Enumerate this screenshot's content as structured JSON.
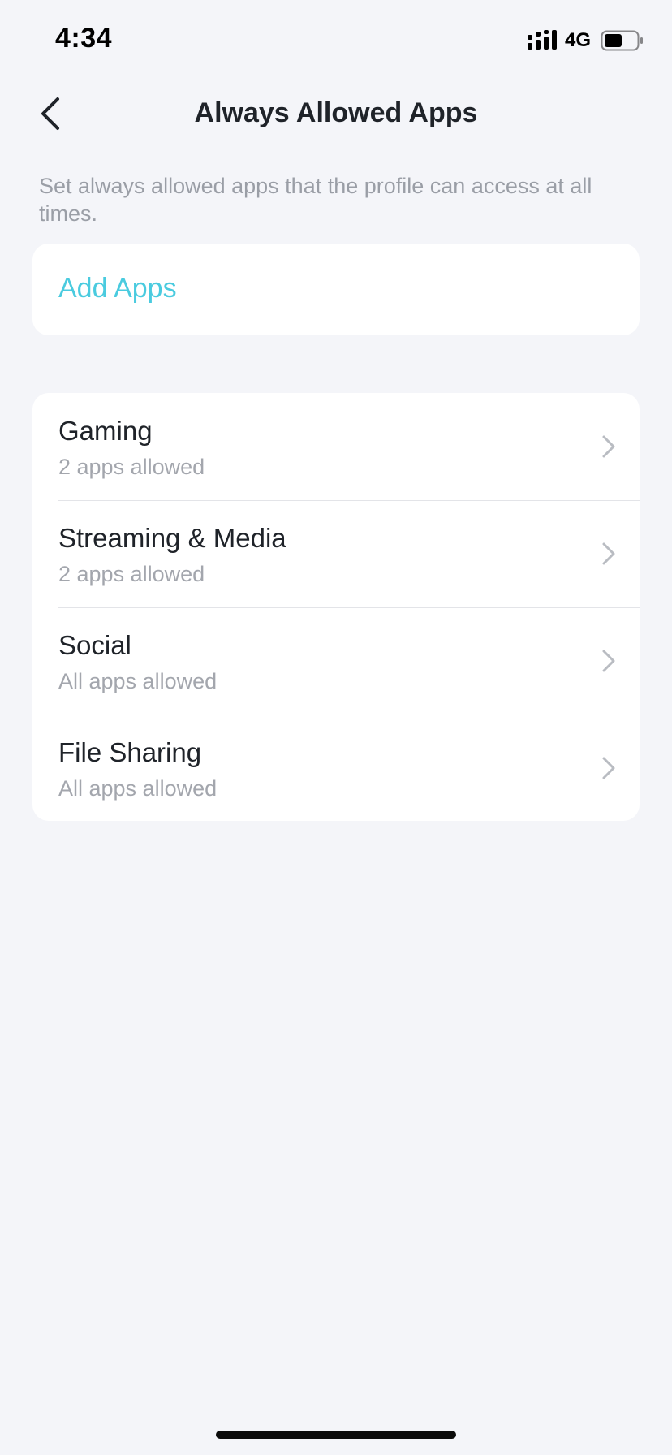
{
  "status_bar": {
    "time": "4:34",
    "network": "4G",
    "icons": [
      "signal-icon",
      "battery-icon"
    ]
  },
  "nav": {
    "title": "Always Allowed Apps",
    "back_icon": "chevron-left-icon"
  },
  "description": "Set always allowed apps that the profile can access at all times.",
  "add_apps": {
    "label": "Add Apps"
  },
  "categories": [
    {
      "title": "Gaming",
      "subtitle": "2 apps allowed"
    },
    {
      "title": "Streaming & Media",
      "subtitle": "2 apps allowed"
    },
    {
      "title": "Social",
      "subtitle": "All apps allowed"
    },
    {
      "title": "File Sharing",
      "subtitle": "All apps allowed"
    }
  ],
  "colors": {
    "accent": "#4acbdf",
    "background": "#f4f5f9",
    "card": "#ffffff",
    "primary_text": "#1f2329",
    "secondary_text": "#a3a6ad"
  }
}
